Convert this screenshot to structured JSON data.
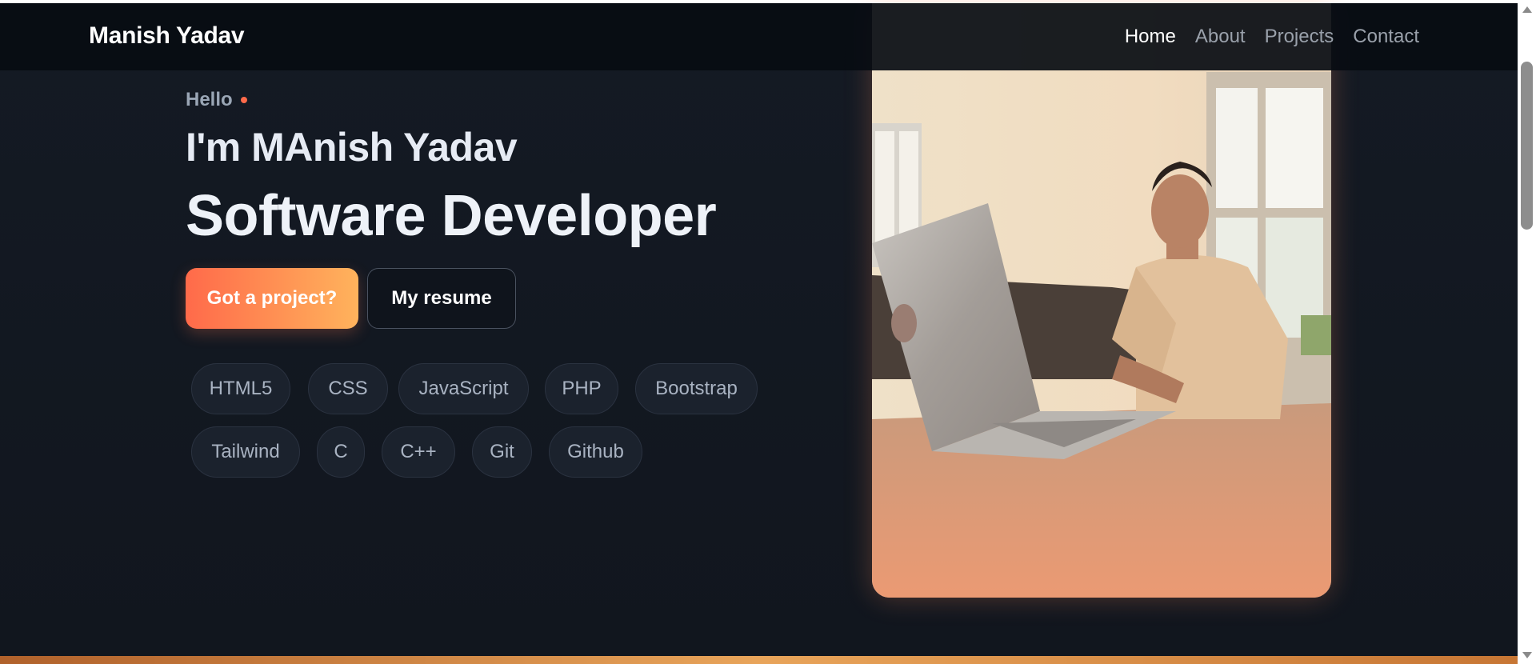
{
  "nav": {
    "brand": "Manish Yadav",
    "links": [
      {
        "label": "Home",
        "active": true
      },
      {
        "label": "About",
        "active": false
      },
      {
        "label": "Projects",
        "active": false
      },
      {
        "label": "Contact",
        "active": false
      }
    ]
  },
  "hero": {
    "greeting": "Hello",
    "intro": "I'm MAnish Yadav",
    "role": "Software Developer",
    "primary_button": "Got a project?",
    "secondary_button": "My resume",
    "skills": [
      "HTML5",
      "CSS",
      "JavaScript",
      "PHP",
      "Bootstrap",
      "Tailwind",
      "C",
      "C++",
      "Git",
      "Github"
    ]
  },
  "colors": {
    "background": "#121821",
    "accent_start": "#ff6a4a",
    "accent_end": "#ffb35c",
    "text_primary": "#ffffff",
    "text_muted": "#9aa1ab"
  }
}
